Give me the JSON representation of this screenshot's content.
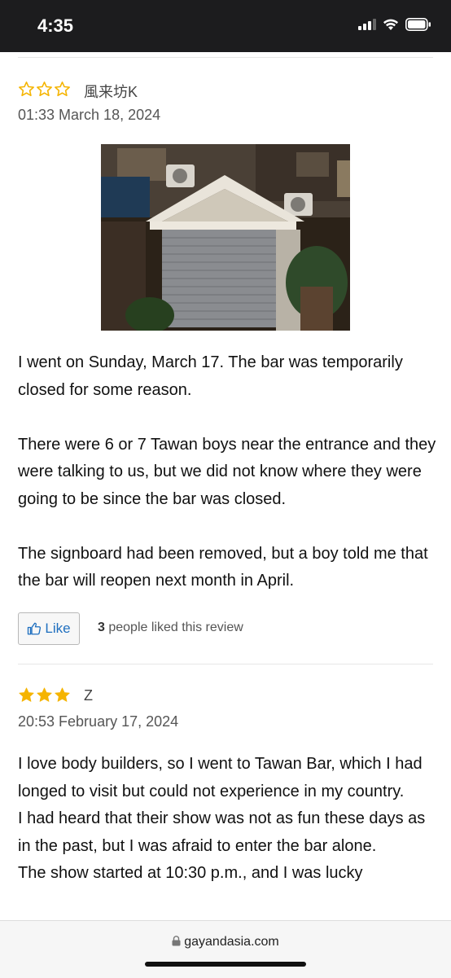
{
  "status_bar": {
    "time": "4:35"
  },
  "reviews": [
    {
      "rating": 0,
      "max_rating": 3,
      "reviewer": "風来坊K",
      "timestamp": "01:33 March 18, 2024",
      "has_photo": true,
      "paragraphs": [
        "I went on Sunday, March 17. The bar was temporarily closed for some reason.",
        "There were 6 or 7 Tawan boys near the entrance and they were talking to us, but we did not know where they were going to be since the bar was closed.",
        "The signboard had been removed, but a boy told me that the bar will reopen next month in April."
      ],
      "like_label": "Like",
      "like_count": "3",
      "like_text": "people liked this review"
    },
    {
      "rating": 3,
      "max_rating": 3,
      "reviewer": "Z",
      "timestamp": "20:53 February 17, 2024",
      "text": "I love body builders, so I went to Tawan Bar, which I had longed to visit but could not experience in my country.\nI had heard that their show was not as fun these days as in the past, but I was afraid to enter the bar alone.\nThe show started at 10:30 p.m., and I was lucky"
    }
  ],
  "browser": {
    "url": "gayandasia.com"
  },
  "colors": {
    "star": "#f5b400",
    "like_blue": "#1f6fbf"
  },
  "icons": {
    "star": "star-icon",
    "like": "thumbs-up-icon",
    "lock": "lock-icon"
  }
}
